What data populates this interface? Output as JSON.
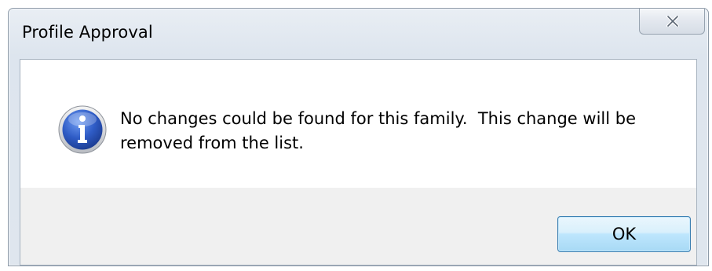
{
  "window": {
    "title": "Profile Approval",
    "close_icon": "close-x-icon"
  },
  "message": {
    "icon": "information-icon",
    "text": "No changes could be found for this family.  This change will be\nremoved from the list."
  },
  "buttons": {
    "ok_label": "OK"
  },
  "colors": {
    "icon_blue": "#2a54b8",
    "button_border": "#3c7fb1",
    "button_fill": "#bee6fd"
  }
}
